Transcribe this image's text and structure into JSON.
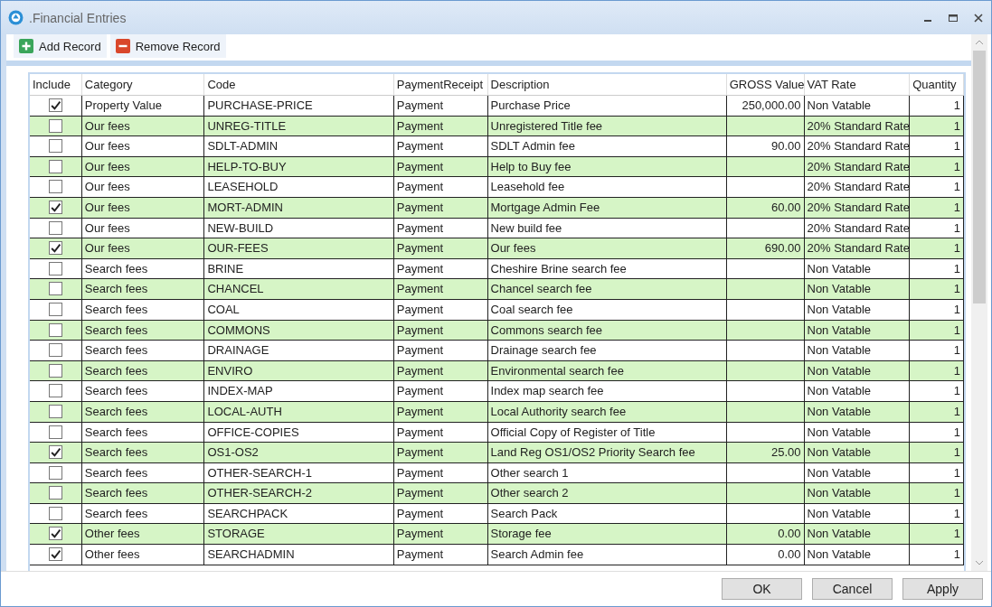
{
  "window": {
    "title": ".Financial Entries"
  },
  "toolbar": [
    {
      "kind": "add",
      "label": "Add Record"
    },
    {
      "kind": "remove",
      "label": "Remove Record"
    }
  ],
  "table": {
    "columns": [
      "Include",
      "Category",
      "Code",
      "PaymentReceipt",
      "Description",
      "GROSS Value",
      "VAT Rate",
      "Quantity"
    ],
    "rows": [
      {
        "checked": true,
        "category": "Property  Value",
        "code": "PURCHASE-PRICE",
        "payment_receipt": "Payment",
        "description": "Purchase Price",
        "gross_value": "250,000.00",
        "vat_rate": "Non Vatable",
        "quantity": "1"
      },
      {
        "checked": false,
        "category": "Our fees",
        "code": "UNREG-TITLE",
        "payment_receipt": "Payment",
        "description": "Unregistered Title fee",
        "gross_value": "",
        "vat_rate": "20% Standard Rate",
        "quantity": "1"
      },
      {
        "checked": false,
        "category": "Our fees",
        "code": "SDLT-ADMIN",
        "payment_receipt": "Payment",
        "description": "SDLT Admin fee",
        "gross_value": "90.00",
        "vat_rate": "20% Standard Rate",
        "quantity": "1"
      },
      {
        "checked": false,
        "category": "Our fees",
        "code": "HELP-TO-BUY",
        "payment_receipt": "Payment",
        "description": "Help to Buy fee",
        "gross_value": "",
        "vat_rate": "20% Standard Rate",
        "quantity": "1"
      },
      {
        "checked": false,
        "category": "Our fees",
        "code": "LEASEHOLD",
        "payment_receipt": "Payment",
        "description": "Leasehold fee",
        "gross_value": "",
        "vat_rate": "20% Standard Rate",
        "quantity": "1"
      },
      {
        "checked": true,
        "category": "Our fees",
        "code": "MORT-ADMIN",
        "payment_receipt": "Payment",
        "description": "Mortgage Admin Fee",
        "gross_value": "60.00",
        "vat_rate": "20% Standard Rate",
        "quantity": "1"
      },
      {
        "checked": false,
        "category": "Our fees",
        "code": "NEW-BUILD",
        "payment_receipt": "Payment",
        "description": "New build fee",
        "gross_value": "",
        "vat_rate": "20% Standard Rate",
        "quantity": "1"
      },
      {
        "checked": true,
        "category": "Our fees",
        "code": "OUR-FEES",
        "payment_receipt": "Payment",
        "description": "Our fees",
        "gross_value": "690.00",
        "vat_rate": "20% Standard Rate",
        "quantity": "1"
      },
      {
        "checked": false,
        "category": "Search fees",
        "code": "BRINE",
        "payment_receipt": "Payment",
        "description": "Cheshire Brine search fee",
        "gross_value": "",
        "vat_rate": "Non Vatable",
        "quantity": "1"
      },
      {
        "checked": false,
        "category": "Search fees",
        "code": "CHANCEL",
        "payment_receipt": "Payment",
        "description": "Chancel search fee",
        "gross_value": "",
        "vat_rate": "Non Vatable",
        "quantity": "1"
      },
      {
        "checked": false,
        "category": "Search fees",
        "code": "COAL",
        "payment_receipt": "Payment",
        "description": "Coal search fee",
        "gross_value": "",
        "vat_rate": "Non Vatable",
        "quantity": "1"
      },
      {
        "checked": false,
        "category": "Search fees",
        "code": "COMMONS",
        "payment_receipt": "Payment",
        "description": "Commons search fee",
        "gross_value": "",
        "vat_rate": "Non Vatable",
        "quantity": "1"
      },
      {
        "checked": false,
        "category": "Search fees",
        "code": "DRAINAGE",
        "payment_receipt": "Payment",
        "description": "Drainage search fee",
        "gross_value": "",
        "vat_rate": "Non Vatable",
        "quantity": "1"
      },
      {
        "checked": false,
        "category": "Search fees",
        "code": "ENVIRO",
        "payment_receipt": "Payment",
        "description": "Environmental search fee",
        "gross_value": "",
        "vat_rate": "Non Vatable",
        "quantity": "1"
      },
      {
        "checked": false,
        "category": "Search fees",
        "code": "INDEX-MAP",
        "payment_receipt": "Payment",
        "description": "Index map search fee",
        "gross_value": "",
        "vat_rate": "Non Vatable",
        "quantity": "1"
      },
      {
        "checked": false,
        "category": "Search fees",
        "code": "LOCAL-AUTH",
        "payment_receipt": "Payment",
        "description": "Local Authority search fee",
        "gross_value": "",
        "vat_rate": "Non Vatable",
        "quantity": "1"
      },
      {
        "checked": false,
        "category": "Search fees",
        "code": "OFFICE-COPIES",
        "payment_receipt": "Payment",
        "description": "Official Copy of Register of Title",
        "gross_value": "",
        "vat_rate": "Non Vatable",
        "quantity": "1"
      },
      {
        "checked": true,
        "category": "Search fees",
        "code": "OS1-OS2",
        "payment_receipt": "Payment",
        "description": "Land Reg OS1/OS2 Priority Search fee",
        "gross_value": "25.00",
        "vat_rate": "Non Vatable",
        "quantity": "1"
      },
      {
        "checked": false,
        "category": "Search fees",
        "code": "OTHER-SEARCH-1",
        "payment_receipt": "Payment",
        "description": "Other search 1",
        "gross_value": "",
        "vat_rate": "Non Vatable",
        "quantity": "1"
      },
      {
        "checked": false,
        "category": "Search fees",
        "code": "OTHER-SEARCH-2",
        "payment_receipt": "Payment",
        "description": "Other search 2",
        "gross_value": "",
        "vat_rate": "Non Vatable",
        "quantity": "1"
      },
      {
        "checked": false,
        "category": "Search fees",
        "code": "SEARCHPACK",
        "payment_receipt": "Payment",
        "description": "Search Pack",
        "gross_value": "",
        "vat_rate": "Non Vatable",
        "quantity": "1"
      },
      {
        "checked": true,
        "category": "Other fees",
        "code": "STORAGE",
        "payment_receipt": "Payment",
        "description": "Storage fee",
        "gross_value": "0.00",
        "vat_rate": "Non Vatable",
        "quantity": "1"
      },
      {
        "checked": true,
        "category": "Other fees",
        "code": "SEARCHADMIN",
        "payment_receipt": "Payment",
        "description": "Search Admin fee",
        "gross_value": "0.00",
        "vat_rate": "Non Vatable",
        "quantity": "1"
      }
    ]
  },
  "buttons": [
    "OK",
    "Cancel",
    "Apply"
  ]
}
